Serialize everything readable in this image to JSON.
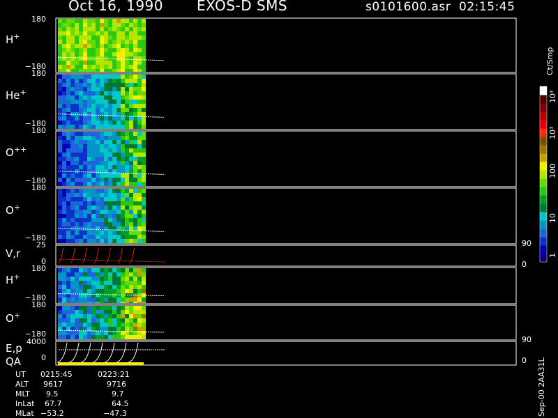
{
  "header": {
    "date": "Oct 16, 1990",
    "instrument": "EXOS-D SMS",
    "file_time": "s0101600.asr  02:15:45"
  },
  "panels": [
    {
      "label_main": "H",
      "label_sup": "+",
      "tick_top": "180",
      "tick_bottom": "−180"
    },
    {
      "label_main": "He",
      "label_sup": "+",
      "tick_top": "180",
      "tick_bottom": "−180"
    },
    {
      "label_main": "O",
      "label_sup": "++",
      "tick_top": "180",
      "tick_bottom": "−180"
    },
    {
      "label_main": "O",
      "label_sup": "+",
      "tick_top": "180",
      "tick_bottom": "−180"
    },
    {
      "label_main": "V,r",
      "label_sup": "",
      "tick_top": "25",
      "tick_bottom": "0",
      "right_top": "90",
      "right_bottom": "0"
    },
    {
      "label_main": "H",
      "label_sup": "+",
      "tick_top": "180",
      "tick_bottom": "−180"
    },
    {
      "label_main": "O",
      "label_sup": "+",
      "tick_top": "180",
      "tick_bottom": "−180"
    },
    {
      "label_main": "E,p",
      "label_sup": "",
      "label_sub": "QA",
      "tick_top": "4000",
      "tick_bottom": "0",
      "right_top": "90",
      "right_bottom": "0"
    }
  ],
  "colorbar": {
    "unit": "Ct/Smp",
    "ticks": [
      "1",
      "10",
      "100",
      "10³",
      "10⁴"
    ],
    "colors": [
      "#00007a",
      "#0000b4",
      "#0a32c8",
      "#1e64dc",
      "#0096c8",
      "#00c8c8",
      "#007832",
      "#00a028",
      "#28c814",
      "#64dc00",
      "#b4e600",
      "#f0f000",
      "#c8a000",
      "#967800",
      "#785000",
      "#ff2800",
      "#e60000",
      "#b40000",
      "#820000",
      "#500000",
      "#ffffff"
    ]
  },
  "footer": {
    "rows": [
      {
        "label": "UT",
        "v1": "0215:45",
        "v2": "0223:21"
      },
      {
        "label": "ALT",
        "v1": "9617",
        "v2": "9716"
      },
      {
        "label": "MLT",
        "v1": "9.5",
        "v2": "9.7"
      },
      {
        "label": "InLat",
        "v1": "67.7",
        "v2": "64.5"
      },
      {
        "label": "MLat",
        "v1": "−53.2",
        "v2": "−47.3"
      }
    ],
    "stamp": "Sep-00 2AA31L"
  },
  "chart_data": {
    "type": "heatmap",
    "title": "Oct 16, 1990   EXOS-D SMS",
    "x_time_labels": [
      "0215:45",
      "0223:21"
    ],
    "y_range_angle": [
      -180,
      180
    ],
    "color_scale": "log",
    "color_range": [
      1,
      10000
    ],
    "color_unit": "Ct/Smp",
    "series": [
      {
        "name": "H+",
        "typical_level": 100
      },
      {
        "name": "He+",
        "typical_level": 3
      },
      {
        "name": "O++",
        "typical_level": 3
      },
      {
        "name": "O+",
        "typical_level": 3
      },
      {
        "name": "V,r",
        "y_range": [
          0,
          25
        ],
        "right_axis_range": [
          0,
          90
        ]
      },
      {
        "name": "H+",
        "typical_level": 5
      },
      {
        "name": "O+",
        "typical_level": 5
      },
      {
        "name": "E,p",
        "y_range": [
          0,
          4000
        ],
        "right_axis_range": [
          0,
          90
        ]
      }
    ]
  }
}
